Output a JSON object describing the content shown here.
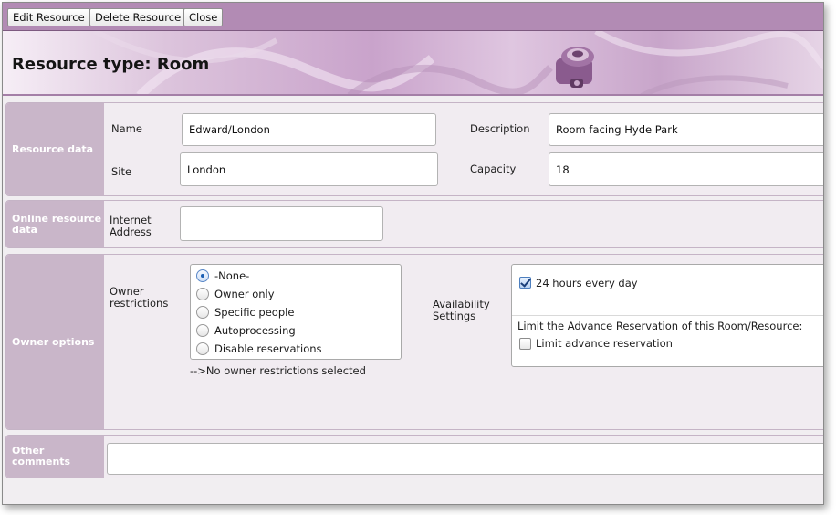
{
  "toolbar": {
    "edit_label": "Edit Resource",
    "delete_label": "Delete Resource",
    "close_label": "Close"
  },
  "header": {
    "title": "Resource type: Room",
    "banner_icon": "projector-icon"
  },
  "resource_data": {
    "section_label": "Resource data",
    "name_label": "Name",
    "name_value": "Edward/London",
    "description_label": "Description",
    "description_value": "Room facing Hyde Park",
    "site_label": "Site",
    "site_value": "London",
    "capacity_label": "Capacity",
    "capacity_value": "18"
  },
  "online_data": {
    "section_label": "Online resource data",
    "internet_label": "Internet Address",
    "internet_value": ""
  },
  "owner_options": {
    "section_label": "Owner options",
    "restrictions_label": "Owner restrictions",
    "options": [
      "-None-",
      "Owner only",
      "Specific people",
      "Autoprocessing",
      "Disable reservations"
    ],
    "selected": "-None-",
    "status_text": "-->No owner restrictions selected",
    "availability_label": "Availability Settings",
    "hours_checkbox_label": "24 hours every day",
    "hours_checked": true,
    "limit_heading": "Limit the Advance Reservation of this Room/Resource:",
    "limit_checkbox_label": "Limit advance reservation",
    "limit_checked": false
  },
  "other_comments": {
    "section_label": "Other comments",
    "value": ""
  },
  "colors": {
    "toolbar": "#b28bb4",
    "section_label_bg": "#c9b6c9",
    "panel_bg": "#f1ecf1"
  }
}
